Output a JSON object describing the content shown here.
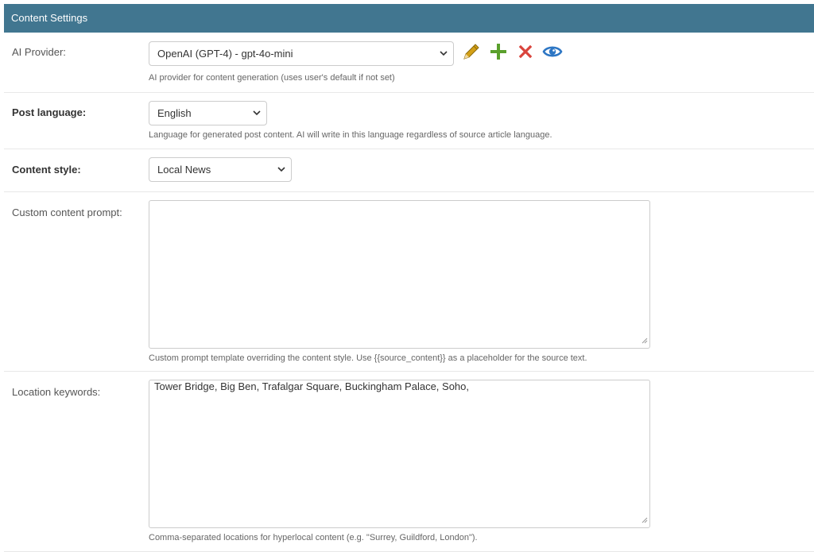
{
  "module": {
    "title": "Content Settings"
  },
  "ai_provider": {
    "label": "AI Provider:",
    "selected": "OpenAI (GPT-4) - gpt-4o-mini",
    "help": "AI provider for content generation (uses user's default if not set)",
    "icons": [
      "pencil-icon",
      "plus-icon",
      "close-icon",
      "eye-icon"
    ]
  },
  "post_language": {
    "label": "Post language:",
    "selected": "English",
    "help": "Language for generated post content. AI will write in this language regardless of source article language."
  },
  "content_style": {
    "label": "Content style:",
    "selected": "Local News"
  },
  "custom_prompt": {
    "label": "Custom content prompt:",
    "value": "",
    "help": "Custom prompt template overriding the content style. Use {{source_content}} as a placeholder for the source text."
  },
  "location_keywords": {
    "label": "Location keywords:",
    "value": "Tower Bridge, Big Ben, Trafalgar Square, Buckingham Palace, Soho,",
    "help": "Comma-separated locations for hyperlocal content (e.g. \"Surrey, Guildford, London\")."
  },
  "colors": {
    "header_bg": "#417690",
    "pencil": "#d4a017",
    "plus": "#5aa02c",
    "close": "#d9443c",
    "eye": "#2d76c4"
  }
}
